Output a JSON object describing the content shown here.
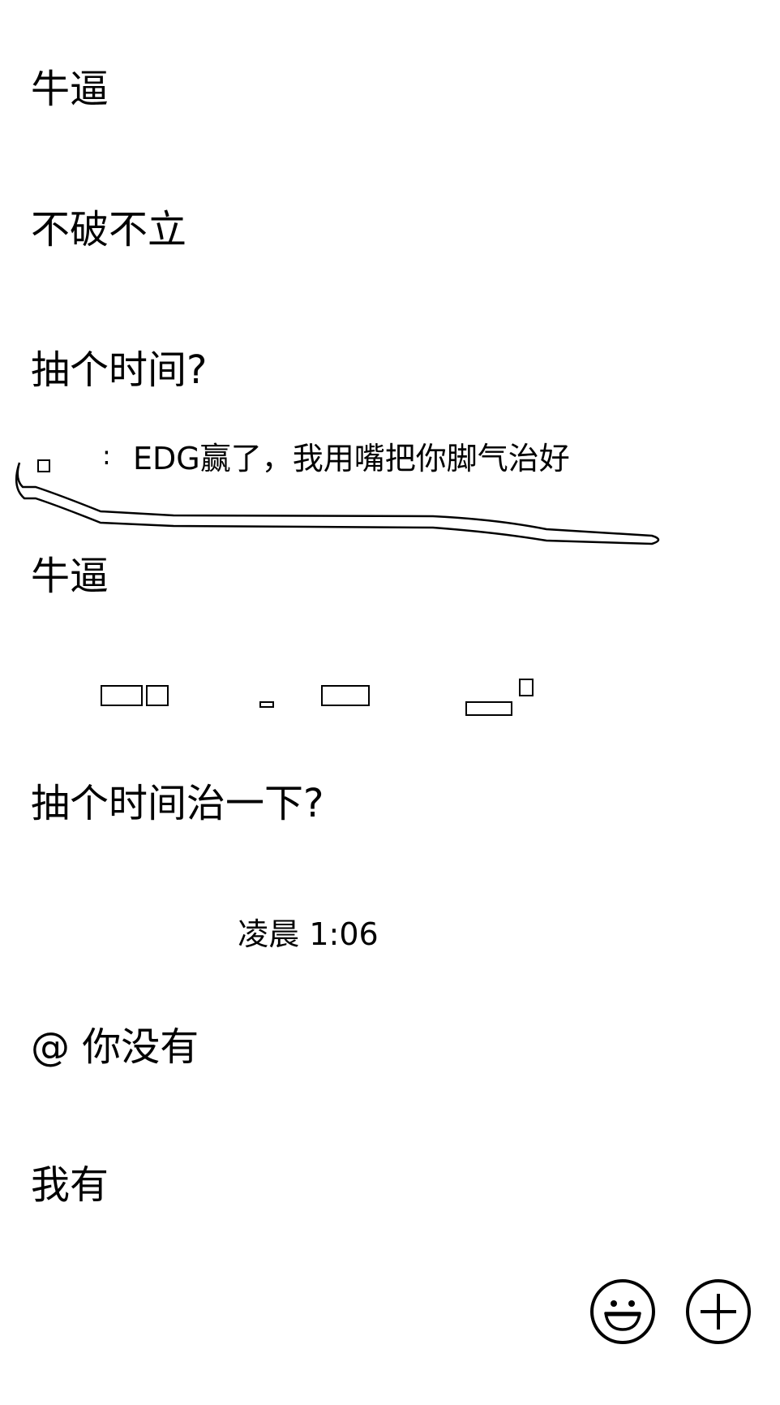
{
  "messages": [
    {
      "text": "牛逼"
    },
    {
      "text": "不破不立"
    },
    {
      "text": "抽个时间?"
    },
    {
      "text": "牛逼"
    },
    {
      "text": "抽个时间治一下?"
    },
    {
      "text": "@ 你没有"
    },
    {
      "text": "我有"
    }
  ],
  "quote": {
    "separator": ":",
    "text": "EDG赢了，我用嘴把你脚气治好"
  },
  "timestamp": "凌晨 1:06",
  "toolbar": {
    "emoji_icon": "smiley-icon",
    "plus_icon": "plus-circle-icon"
  }
}
